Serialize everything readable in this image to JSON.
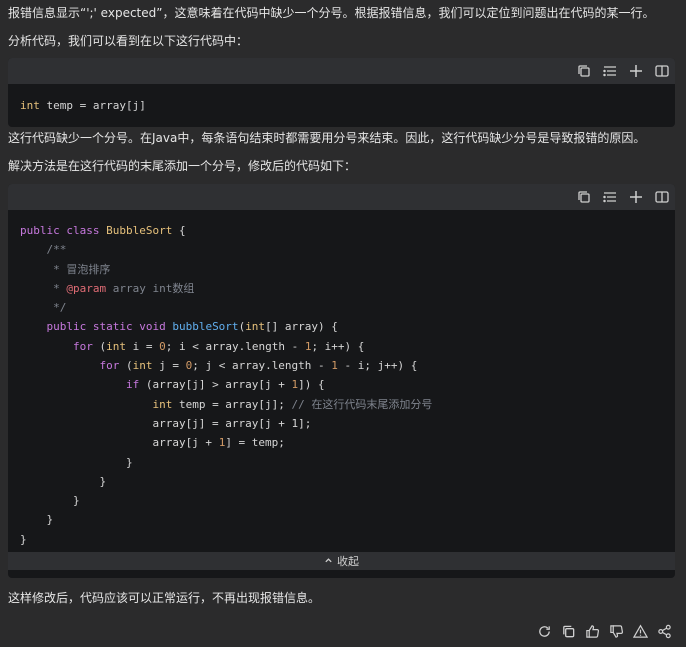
{
  "paragraphs": {
    "p1": "报错信息显示“';' expected”，这意味着在代码中缺少一个分号。根据报错信息，我们可以定位到问题出在代码的某一行。",
    "p2": "分析代码，我们可以看到在以下这行代码中：",
    "p3": "这行代码缺少一个分号。在Java中，每条语句结束时都需要用分号来结束。因此，这行代码缺少分号是导致报错的原因。",
    "p4": "解决方法是在这行代码的末尾添加一个分号，修改后的代码如下：",
    "p5": "这样修改后，代码应该可以正常运行，不再出现报错信息。"
  },
  "toolbar_icons": [
    "copy-icon",
    "wrap-lines-icon",
    "insert-icon",
    "split-view-icon"
  ],
  "code1": {
    "type": "int",
    "rest": " temp = array[j]"
  },
  "code2": {
    "l1_a": "public class ",
    "l1_b": "BubbleSort",
    "l1_c": " {",
    "l2": "    /**",
    "l3": "     * 冒泡排序",
    "l4_a": "     * ",
    "l4_b": "@param",
    "l4_c": " array int数组",
    "l5": "     */",
    "l6_a": "    public static void ",
    "l6_b": "bubbleSort",
    "l6_c": "(",
    "l6_d": "int",
    "l6_e": "[] array) {",
    "l7_a": "        for",
    "l7_b": " (",
    "l7_c": "int",
    "l7_d": " i = ",
    "l7_e": "0",
    "l7_f": "; i < array.length - ",
    "l7_g": "1",
    "l7_h": "; i++) {",
    "l8_a": "            for",
    "l8_b": " (",
    "l8_c": "int",
    "l8_d": " j = ",
    "l8_e": "0",
    "l8_f": "; j < array.length - ",
    "l8_g": "1",
    "l8_h": " - i; j++) {",
    "l9_a": "                if",
    "l9_b": " (array[j] > array[j + ",
    "l9_c": "1",
    "l9_d": "]) {",
    "l10_a": "                    int",
    "l10_b": " temp = array[j]; ",
    "l10_c": "// 在这行代码末尾添加分号",
    "l11": "                    array[j] = array[j + 1];",
    "l12_a": "                    array[j + ",
    "l12_b": "1",
    "l12_c": "] = temp;",
    "l13": "                }",
    "l14": "            }",
    "l15": "        }",
    "l16": "    }",
    "l17": "}"
  },
  "collapse_label": "收起",
  "actions": [
    "refresh-icon",
    "copy-icon",
    "thumbs-up-icon",
    "thumbs-down-icon",
    "warning-icon",
    "share-icon"
  ]
}
